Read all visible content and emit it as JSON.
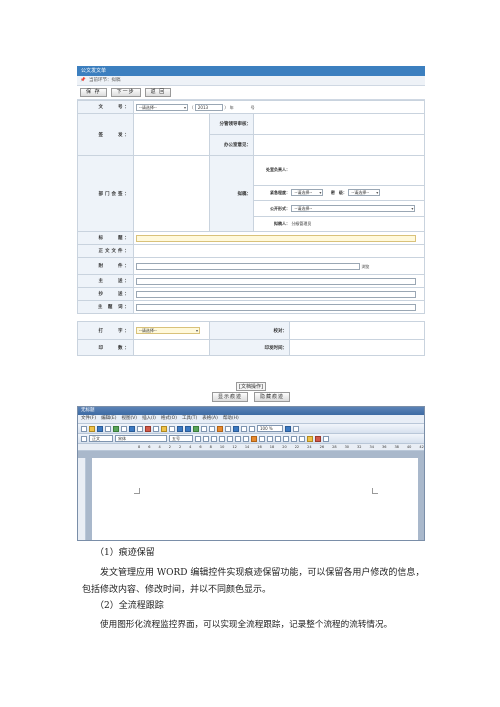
{
  "window": {
    "title": "公文发文单"
  },
  "breadcrumb": {
    "text": "当前环节：拟稿"
  },
  "toolbar": {
    "save": "保 存",
    "next": "下一步",
    "back": "返 回"
  },
  "form": {
    "wenhao_label": "文　　号：",
    "wenhao_select": "--请选择--",
    "wenhao_year": "2013",
    "wenhao_suffix_year": "年",
    "wenhao_suffix_no": "号",
    "qianfa_label": "签　　发：",
    "fenguan_label": "分管领导审核：",
    "bangong_label": "办公室意见：",
    "bumen_label": "部门会签：",
    "bangong_fuze_label": "处室负责人：",
    "nigao_label": "拟稿：",
    "jinji_label": "紧急程度：",
    "jinji_value": "--请选择--",
    "miji_label": "密　级：",
    "miji_value": "--请选择--",
    "gongkai_label": "公开形式：",
    "gongkai_value": "--请选择--",
    "nigaoren_label": "拟稿人：",
    "nigaoren_value": "分級管理员",
    "biaoti_label": "标　　题：",
    "zhengwen_label": "正文文件：",
    "fujian_label": "附　　件：",
    "browse_label": "浏览",
    "zhusong_label": "主　　送：",
    "chaosong_label": "抄　　送：",
    "zhuti_label": "主 题 词：",
    "dazi_label": "打　　字：",
    "dazi_value": "--请选择--",
    "jiaodui_label": "校对：",
    "yinshu_label": "印　　数：",
    "yinfa_label": "印发时间："
  },
  "doc_ops": {
    "title": "[文档操作]",
    "show_trace": "显示痕迹",
    "hide_trace": "隐藏痕迹"
  },
  "word": {
    "title": "无标题",
    "menus": [
      "文件(F)",
      "编辑(E)",
      "视图(V)",
      "插入(I)",
      "格式(O)",
      "工具(T)",
      "表格(A)",
      "帮助(H)"
    ],
    "style_value": "正文",
    "font_value": "宋体",
    "size_value": "五号",
    "zoom_value": "100 %",
    "ruler_ticks": [
      "8",
      "6",
      "4",
      "2",
      "2",
      "4",
      "6",
      "8",
      "10",
      "12",
      "14",
      "16",
      "18",
      "20",
      "22",
      "24",
      "26",
      "28",
      "30",
      "32",
      "34",
      "36",
      "38",
      "40",
      "42"
    ]
  },
  "body_text": {
    "h1": "（1）痕迹保留",
    "p1": "发文管理应用 WORD 编辑控件实现痕迹保留功能，可以保留各用户修改的信息，包括修改内容、修改时间，并以不同颜色显示。",
    "h2": "（2）全流程跟踪",
    "p2": "使用图形化流程监控界面，可以实现全流程跟踪，记录整个流程的流转情况。"
  }
}
